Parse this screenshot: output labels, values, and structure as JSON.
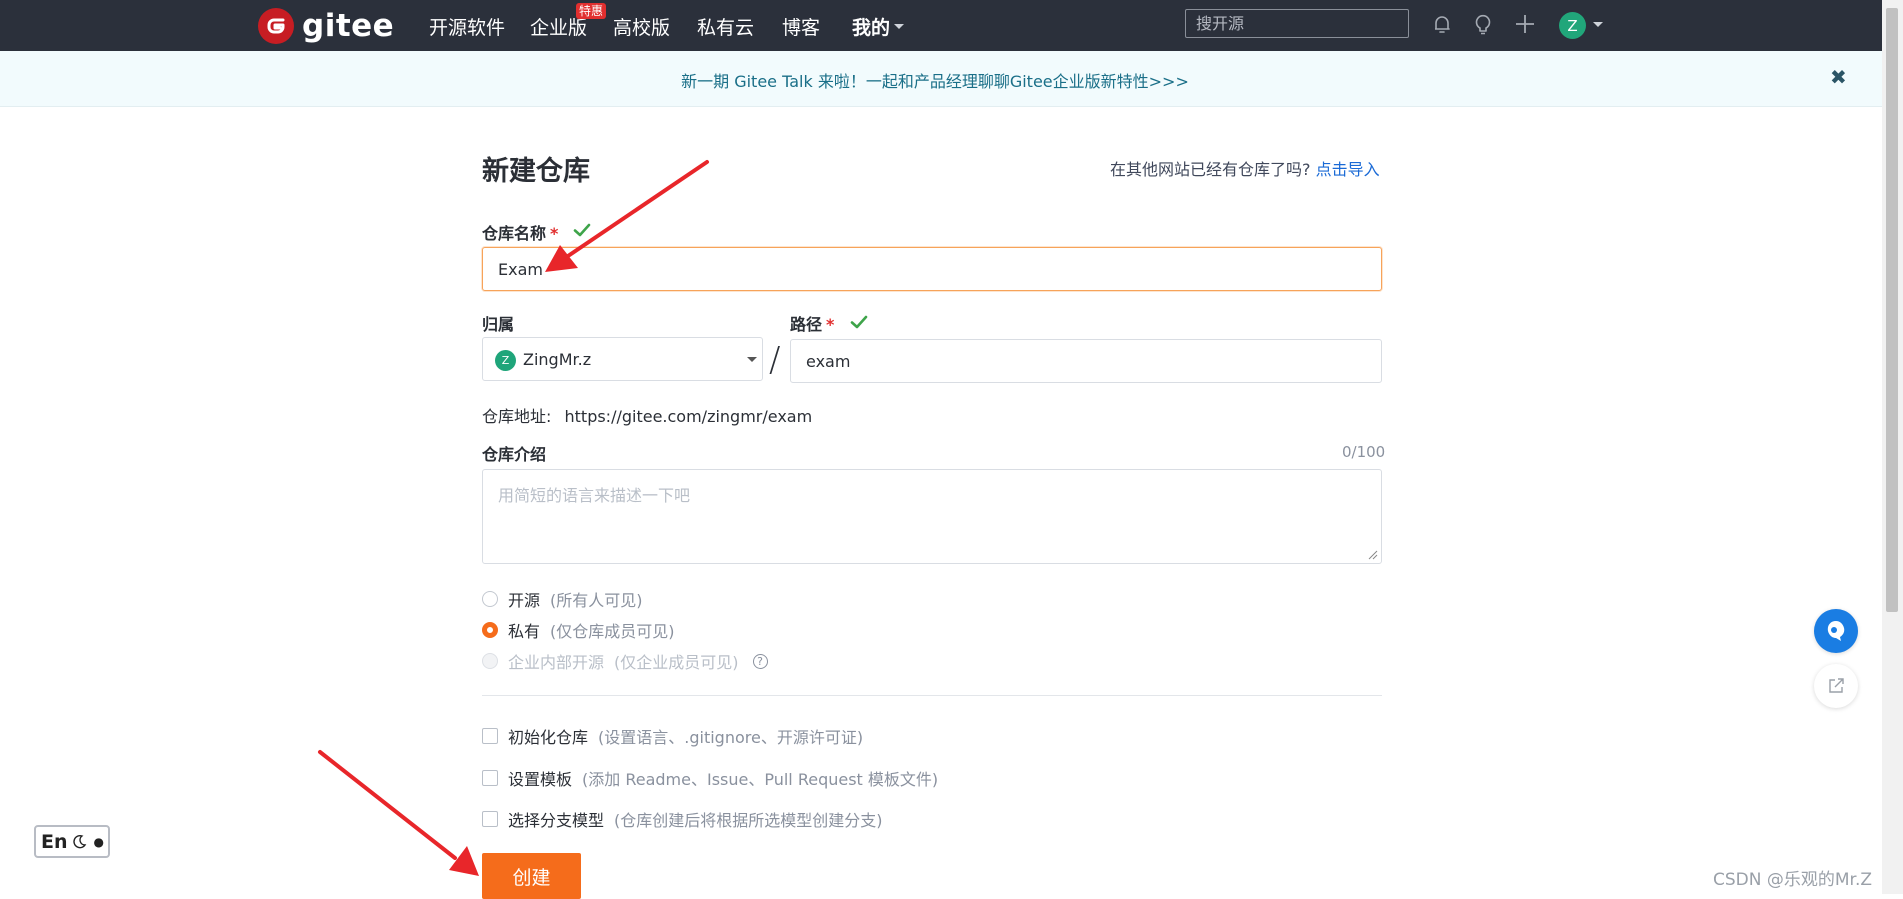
{
  "nav": {
    "logo_text": "gitee",
    "items": [
      "开源软件",
      "企业版",
      "高校版",
      "私有云",
      "博客"
    ],
    "badge": "特惠",
    "mine_label": "我的",
    "search_placeholder": "搜开源",
    "avatar_letter": "Z"
  },
  "banner": {
    "text": "新一期 Gitee Talk 来啦！一起和产品经理聊聊Gitee企业版新特性>>>",
    "close_symbol": "✖"
  },
  "form": {
    "title": "新建仓库",
    "import_hint": "在其他网站已经有仓库了吗?",
    "import_link": "点击导入",
    "repo_name_label": "仓库名称",
    "required_mark": "*",
    "repo_name_value": "Exam",
    "owner_label": "归属",
    "owner_avatar_letter": "Z",
    "owner_name": "ZingMr.z",
    "slash": "/",
    "path_label": "路径",
    "path_value": "exam",
    "repo_address_label": "仓库地址:",
    "repo_address_value": "https://gitee.com/zingmr/exam",
    "intro_label": "仓库介绍",
    "intro_counter": "0/100",
    "intro_placeholder": "用简短的语言来描述一下吧",
    "visibility": [
      {
        "label": "开源",
        "sub": "(所有人可见)",
        "state": "unchecked"
      },
      {
        "label": "私有",
        "sub": "(仅仓库成员可见)",
        "state": "checked"
      },
      {
        "label": "企业内部开源",
        "sub": "(仅企业成员可见)",
        "state": "disabled"
      }
    ],
    "help_symbol": "?",
    "options": [
      {
        "label": "初始化仓库",
        "sub": "(设置语言、.gitignore、开源许可证)"
      },
      {
        "label": "设置模板",
        "sub": "(添加 Readme、Issue、Pull Request 模板文件)"
      },
      {
        "label": "选择分支模型",
        "sub": "(仓库创建后将根据所选模型创建分支)"
      }
    ],
    "create_button": "创建"
  },
  "ime": {
    "text": "En"
  },
  "watermark": "CSDN @乐观的Mr.Z",
  "colors": {
    "nav_bg": "#2b303b",
    "accent_orange": "#f56c1b",
    "logo_red": "#c71d23",
    "link_blue": "#1a6ad6",
    "check_green": "#3ea44a",
    "annotation_red": "#e8262a"
  },
  "icons": [
    "bell-icon",
    "lightbulb-icon",
    "plus-icon",
    "close-icon",
    "check-icon",
    "help-icon",
    "chat-icon",
    "share-icon"
  ]
}
